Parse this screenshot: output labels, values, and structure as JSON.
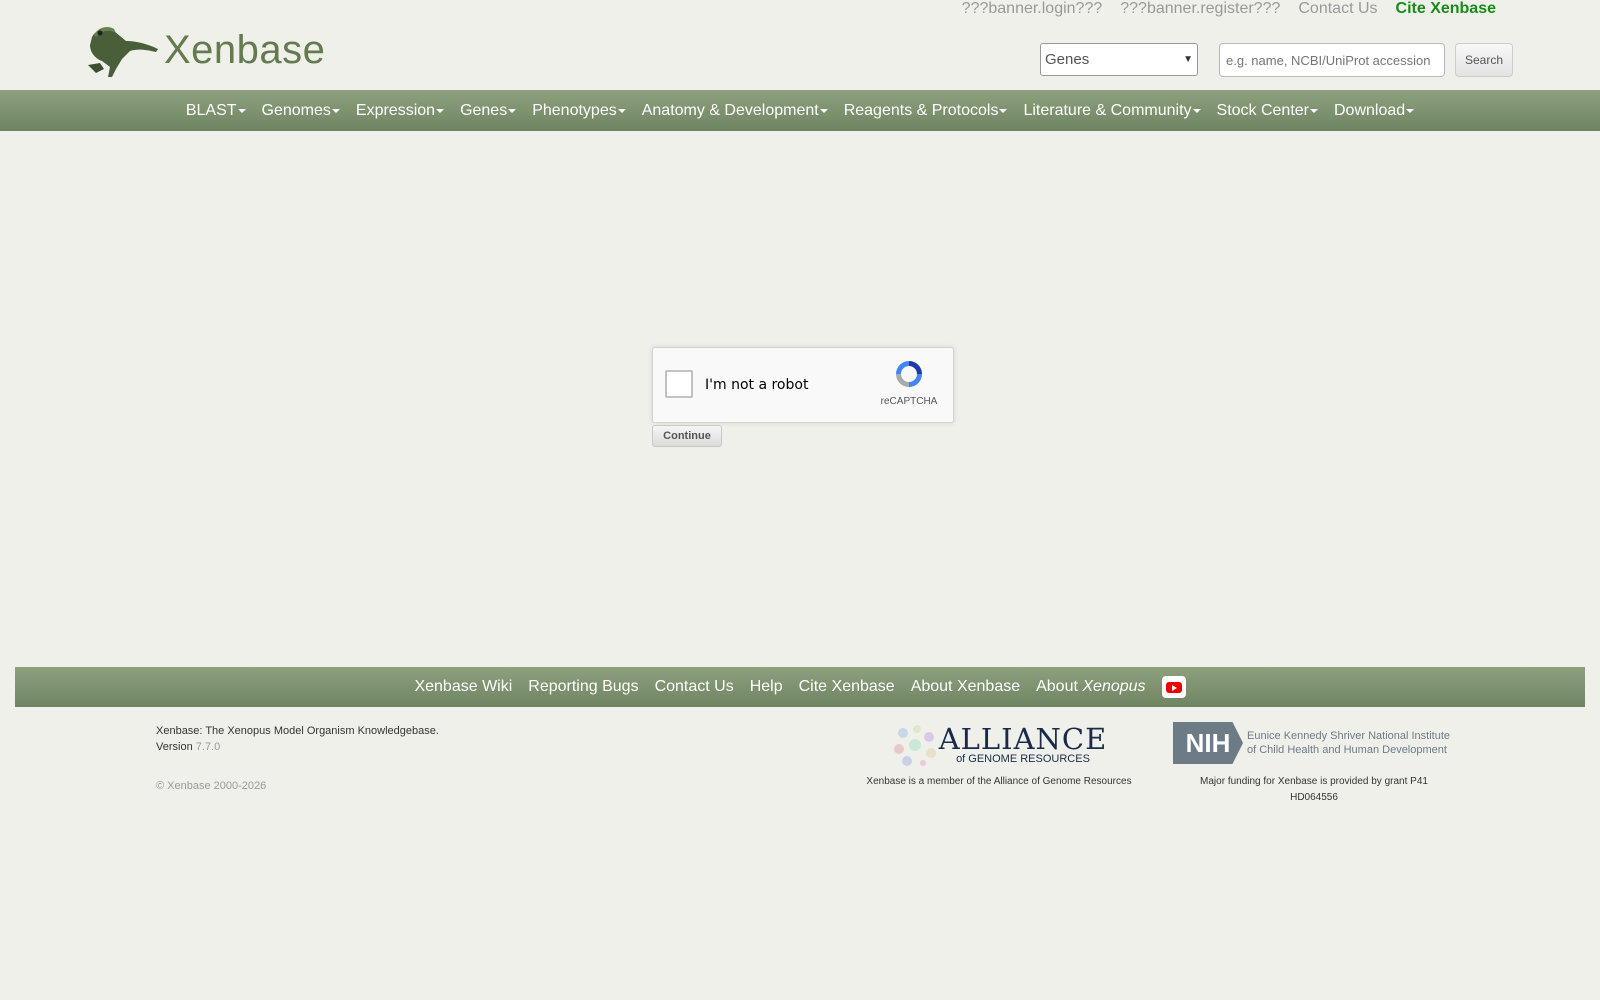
{
  "header": {
    "top_links": [
      "???banner.login???",
      "???banner.register???",
      "Contact Us"
    ],
    "cite": "Cite Xenbase",
    "logo_text": "Xenbase",
    "search_select": "Genes",
    "search_placeholder": "e.g. name, NCBI/UniProt accession",
    "search_button": "Search"
  },
  "nav": [
    "BLAST",
    "Genomes",
    "Expression",
    "Genes",
    "Phenotypes",
    "Anatomy & Development",
    "Reagents & Protocols",
    "Literature & Community",
    "Stock Center",
    "Download"
  ],
  "recaptcha": {
    "label": "I'm not a robot",
    "brand": "reCAPTCHA"
  },
  "continue": "Continue",
  "footer": {
    "links": [
      "Xenbase Wiki",
      "Reporting Bugs",
      "Contact Us",
      "Help",
      "Cite Xenbase",
      "About Xenbase"
    ],
    "about_prefix": "About",
    "about_species": "Xenopus",
    "tagline": "Xenbase: The Xenopus Model Organism Knowledgebase.",
    "version_label": "Version",
    "version": "7.7.0",
    "copyright": "© Xenbase 2000-2026",
    "alliance_big": "ALLIANCE",
    "alliance_small": "of GENOME RESOURCES",
    "alliance_caption": "Xenbase is a member of the Alliance of Genome Resources",
    "nih_box": "NIH",
    "nih_line1": "Eunice Kennedy Shriver National Institute",
    "nih_line2": "of Child Health and Human Development",
    "nih_caption1": "Major funding for Xenbase is provided by grant P41",
    "nih_caption2": "HD064556"
  },
  "colors": {
    "nav_green": "#7d9170",
    "cite_green": "#1a8a1a",
    "logo_green": "#647a4f"
  }
}
